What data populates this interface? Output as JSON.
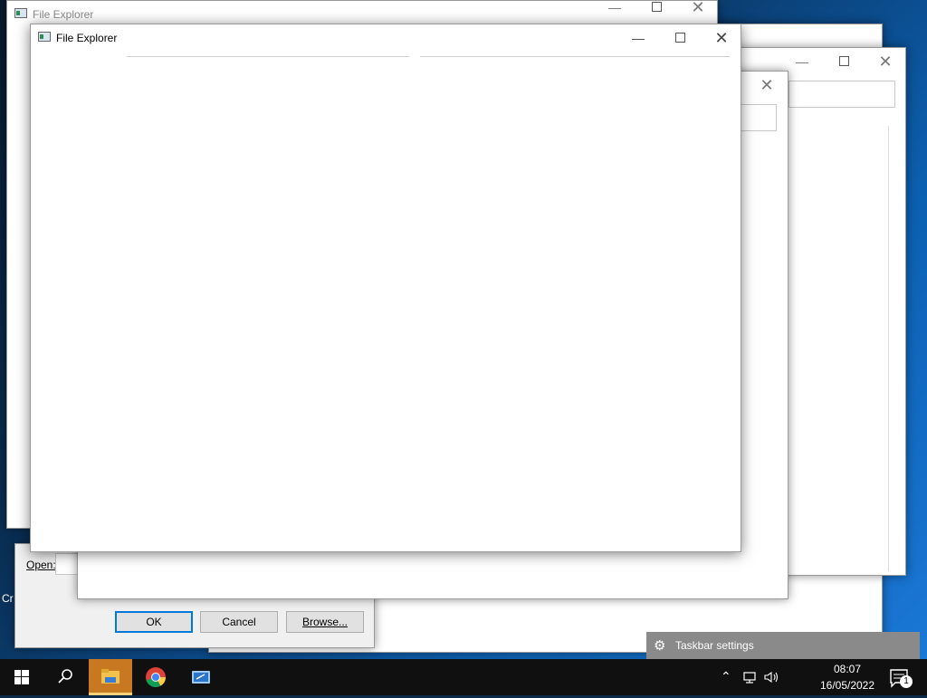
{
  "windows": {
    "back_explorer": {
      "title": "File Explorer"
    },
    "front_explorer": {
      "title": "File Explorer"
    }
  },
  "run_dialog": {
    "open_label": "Open:",
    "ok_label": "OK",
    "cancel_label": "Cancel",
    "browse_label": "Browse...",
    "partial_label": "Cr"
  },
  "taskbar": {
    "time": "08:07",
    "date": "16/05/2022",
    "notification_count": "1",
    "popup_label": "Taskbar settings",
    "icons": [
      "windows-start-icon",
      "search-icon",
      "file-explorer-icon",
      "chrome-icon",
      "run-app-icon"
    ]
  },
  "colors": {
    "accent": "#0078d7",
    "taskbar_bg": "#101010",
    "active_app_highlight": "#c87820"
  }
}
